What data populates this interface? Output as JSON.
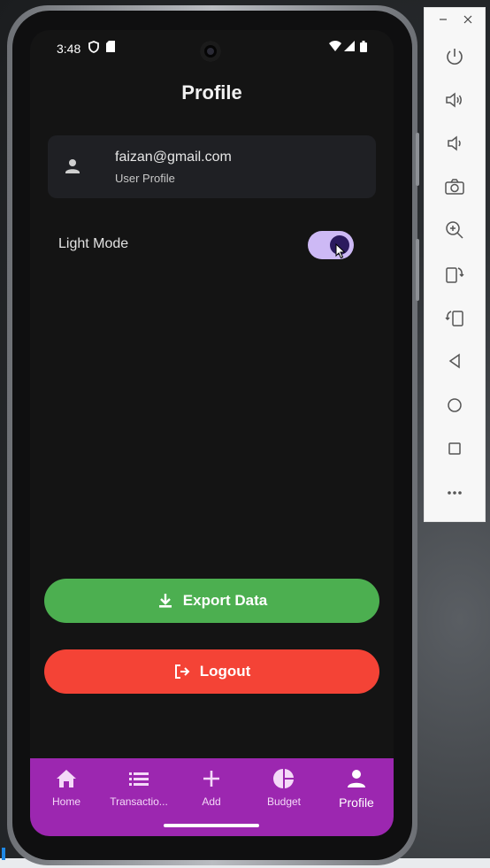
{
  "status_bar": {
    "time": "3:48"
  },
  "header": {
    "title": "Profile"
  },
  "user": {
    "email": "faizan@gmail.com",
    "subtitle": "User Profile"
  },
  "settings": {
    "light_mode_label": "Light Mode",
    "light_mode_on": true
  },
  "actions": {
    "export_label": "Export Data",
    "logout_label": "Logout"
  },
  "bottom_nav": {
    "items": [
      {
        "label": "Home",
        "icon": "home-icon"
      },
      {
        "label": "Transactio...",
        "icon": "list-icon"
      },
      {
        "label": "Add",
        "icon": "plus-icon"
      },
      {
        "label": "Budget",
        "icon": "pie-chart-icon"
      },
      {
        "label": "Profile",
        "icon": "person-icon"
      }
    ],
    "active": "Profile"
  },
  "emulator_toolbar": {
    "buttons": [
      "power-icon",
      "volume-up-icon",
      "volume-down-icon",
      "camera-icon",
      "zoom-icon",
      "rotate-left-icon",
      "rotate-right-icon",
      "back-icon",
      "home-circle-icon",
      "overview-icon",
      "more-icon"
    ]
  },
  "colors": {
    "screen_bg": "#141414",
    "card_bg": "#1f2024",
    "toggle_track": "#cdb9f5",
    "toggle_knob": "#2b1a5e",
    "export": "#4caf50",
    "logout": "#f44336",
    "nav_bg": "#9c27b0"
  }
}
